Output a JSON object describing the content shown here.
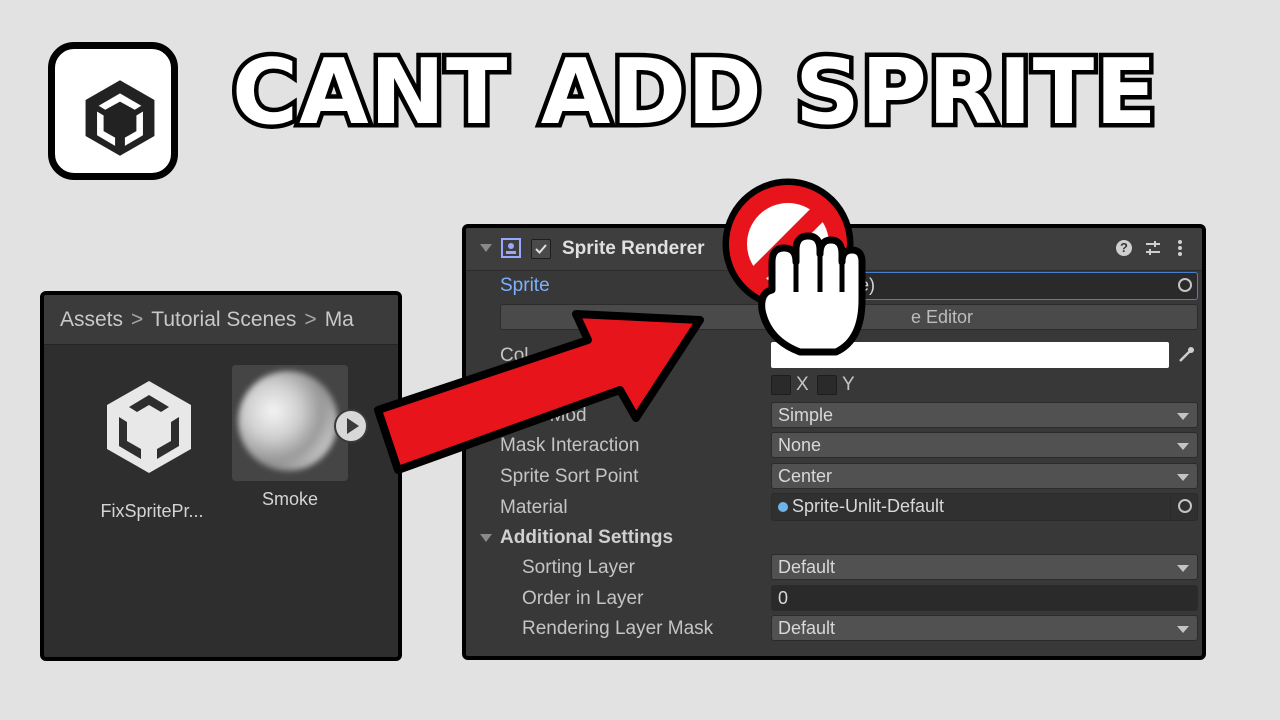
{
  "title": "CANT ADD SPRITE",
  "project_panel": {
    "breadcrumb": [
      "Assets",
      "Tutorial Scenes",
      "Ma"
    ],
    "assets": [
      {
        "label": "FixSpritePr...",
        "icon": "unity-logo-icon"
      },
      {
        "label": "Smoke",
        "icon": "smoke-texture"
      }
    ]
  },
  "inspector": {
    "component_title": "Sprite Renderer",
    "sprite_label": "Sprite",
    "sprite_value": "te)",
    "open_editor_label": "e Editor",
    "color_label": "Col",
    "flip_x": "X",
    "flip_y": "Y",
    "rows": [
      {
        "label": "Draw Mod",
        "value": "Simple"
      },
      {
        "label": "Mask Interaction",
        "value": "None"
      },
      {
        "label": "Sprite Sort Point",
        "value": "Center"
      }
    ],
    "material_label": "Material",
    "material_value": "Sprite-Unlit-Default",
    "additional_settings": "Additional Settings",
    "sorting_layer_label": "Sorting Layer",
    "sorting_layer_value": "Default",
    "order_in_layer_label": "Order in Layer",
    "order_in_layer_value": "0",
    "rendering_layer_mask_label": "Rendering Layer Mask",
    "rendering_layer_mask_value": "Default"
  },
  "colors": {
    "accent_red": "#e8141b",
    "label_blue": "#7fb0ff",
    "panel_bg": "#383838"
  }
}
